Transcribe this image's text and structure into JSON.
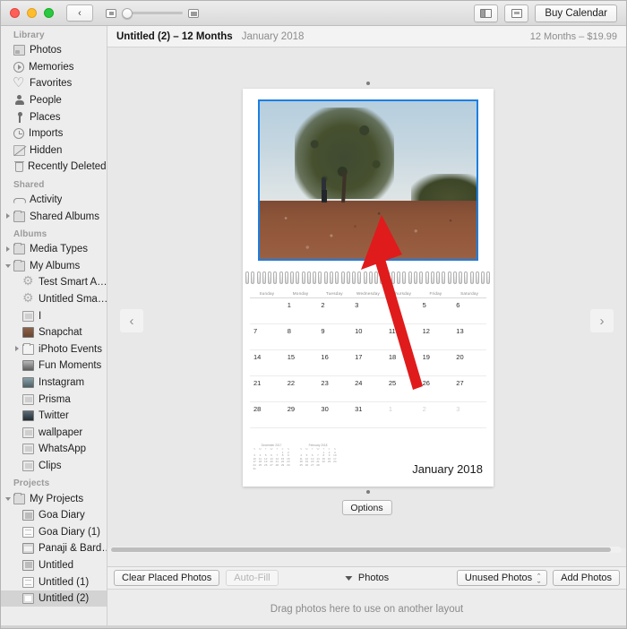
{
  "window": {
    "traffic_lights": [
      "close",
      "minimize",
      "zoom"
    ]
  },
  "toolbar": {
    "back_glyph": "‹",
    "zoom_small_icon": "small-thumbnail-icon",
    "zoom_large_icon": "large-thumbnail-icon",
    "split_view_icon": "split-view-icon",
    "page_view_icon": "page-view-icon",
    "buy_label": "Buy Calendar"
  },
  "sidebar": {
    "sections": [
      {
        "header": "Library",
        "items": [
          {
            "label": "Photos",
            "icon": "photos-icon",
            "indent": 0,
            "disclosure": "none",
            "selected": false
          },
          {
            "label": "Memories",
            "icon": "memories-icon",
            "indent": 0,
            "disclosure": "none",
            "selected": false
          },
          {
            "label": "Favorites",
            "icon": "heart-icon",
            "indent": 0,
            "disclosure": "none",
            "selected": false
          },
          {
            "label": "People",
            "icon": "people-icon",
            "indent": 0,
            "disclosure": "none",
            "selected": false
          },
          {
            "label": "Places",
            "icon": "pin-icon",
            "indent": 0,
            "disclosure": "none",
            "selected": false
          },
          {
            "label": "Imports",
            "icon": "clock-icon",
            "indent": 0,
            "disclosure": "none",
            "selected": false
          },
          {
            "label": "Hidden",
            "icon": "hidden-icon",
            "indent": 0,
            "disclosure": "none",
            "selected": false
          },
          {
            "label": "Recently Deleted",
            "icon": "trash-icon",
            "indent": 0,
            "disclosure": "none",
            "selected": false
          }
        ]
      },
      {
        "header": "Shared",
        "items": [
          {
            "label": "Activity",
            "icon": "cloud-icon",
            "indent": 0,
            "disclosure": "none",
            "selected": false
          },
          {
            "label": "Shared Albums",
            "icon": "folder-grey-icon",
            "indent": 0,
            "disclosure": "right",
            "selected": false
          }
        ]
      },
      {
        "header": "Albums",
        "items": [
          {
            "label": "Media Types",
            "icon": "folder-grey-icon",
            "indent": 0,
            "disclosure": "right",
            "selected": false
          },
          {
            "label": "My Albums",
            "icon": "folder-grey-icon",
            "indent": 0,
            "disclosure": "down",
            "selected": false
          },
          {
            "label": "Test Smart A…",
            "icon": "gear-icon",
            "indent": 1,
            "disclosure": "none",
            "selected": false
          },
          {
            "label": "Untitled Sma…",
            "icon": "gear-icon",
            "indent": 1,
            "disclosure": "none",
            "selected": false
          },
          {
            "label": "I",
            "icon": "album-icon",
            "indent": 1,
            "disclosure": "none",
            "selected": false
          },
          {
            "label": "Snapchat",
            "icon": "album-thumb-snapchat-icon",
            "indent": 1,
            "disclosure": "none",
            "selected": false
          },
          {
            "label": "iPhoto Events",
            "icon": "folder-icon",
            "indent": 1,
            "disclosure": "right",
            "selected": false
          },
          {
            "label": "Fun Moments",
            "icon": "album-thumb-fun-icon",
            "indent": 1,
            "disclosure": "none",
            "selected": false
          },
          {
            "label": "Instagram",
            "icon": "album-thumb-instagram-icon",
            "indent": 1,
            "disclosure": "none",
            "selected": false
          },
          {
            "label": "Prisma",
            "icon": "album-icon",
            "indent": 1,
            "disclosure": "none",
            "selected": false
          },
          {
            "label": "Twitter",
            "icon": "album-thumb-twitter-icon",
            "indent": 1,
            "disclosure": "none",
            "selected": false
          },
          {
            "label": "wallpaper",
            "icon": "album-icon",
            "indent": 1,
            "disclosure": "none",
            "selected": false
          },
          {
            "label": "WhatsApp",
            "icon": "album-icon",
            "indent": 1,
            "disclosure": "none",
            "selected": false
          },
          {
            "label": "Clips",
            "icon": "album-icon",
            "indent": 1,
            "disclosure": "none",
            "selected": false
          }
        ]
      },
      {
        "header": "Projects",
        "items": [
          {
            "label": "My Projects",
            "icon": "folder-grey-icon",
            "indent": 0,
            "disclosure": "down",
            "selected": false
          },
          {
            "label": "Goa Diary",
            "icon": "project-book-icon",
            "indent": 1,
            "disclosure": "none",
            "selected": false
          },
          {
            "label": "Goa Diary (1)",
            "icon": "project-card-icon",
            "indent": 1,
            "disclosure": "none",
            "selected": false
          },
          {
            "label": "Panaji & Bard…",
            "icon": "project-wide-icon",
            "indent": 1,
            "disclosure": "none",
            "selected": false
          },
          {
            "label": "Untitled",
            "icon": "project-book-icon",
            "indent": 1,
            "disclosure": "none",
            "selected": false
          },
          {
            "label": "Untitled (1)",
            "icon": "project-card-icon",
            "indent": 1,
            "disclosure": "none",
            "selected": false
          },
          {
            "label": "Untitled (2)",
            "icon": "project-calendar-icon",
            "indent": 1,
            "disclosure": "none",
            "selected": true
          }
        ]
      }
    ]
  },
  "header": {
    "project_title": "Untitled (2) – 12 Months",
    "month_label": "January 2018",
    "price_label": "12 Months – $19.99"
  },
  "canvas": {
    "prev_glyph": "‹",
    "next_glyph": "›",
    "options_label": "Options",
    "photo_alt": "person standing beside a tree on red earth under a pale blue sky",
    "annotation": "red-arrow-pointing-to-photo"
  },
  "calendar": {
    "month_title": "January 2018",
    "day_headers": [
      "Sunday",
      "Monday",
      "Tuesday",
      "Wednesday",
      "Thursday",
      "Friday",
      "Saturday"
    ],
    "weeks": [
      [
        {
          "d": "",
          "mute": true
        },
        {
          "d": "1"
        },
        {
          "d": "2"
        },
        {
          "d": "3"
        },
        {
          "d": "4"
        },
        {
          "d": "5"
        },
        {
          "d": "6"
        }
      ],
      [
        {
          "d": "7"
        },
        {
          "d": "8"
        },
        {
          "d": "9"
        },
        {
          "d": "10"
        },
        {
          "d": "11"
        },
        {
          "d": "12"
        },
        {
          "d": "13"
        }
      ],
      [
        {
          "d": "14"
        },
        {
          "d": "15"
        },
        {
          "d": "16"
        },
        {
          "d": "17"
        },
        {
          "d": "18"
        },
        {
          "d": "19"
        },
        {
          "d": "20"
        }
      ],
      [
        {
          "d": "21"
        },
        {
          "d": "22"
        },
        {
          "d": "23"
        },
        {
          "d": "24"
        },
        {
          "d": "25"
        },
        {
          "d": "26"
        },
        {
          "d": "27"
        }
      ],
      [
        {
          "d": "28"
        },
        {
          "d": "29"
        },
        {
          "d": "30"
        },
        {
          "d": "31"
        },
        {
          "d": "1",
          "mute": true
        },
        {
          "d": "2",
          "mute": true
        },
        {
          "d": "3",
          "mute": true
        }
      ]
    ],
    "mini_calendars": [
      {
        "title": "December 2017",
        "dow": [
          "S",
          "M",
          "T",
          "W",
          "T",
          "F",
          "S"
        ],
        "cells": [
          "",
          "",
          "",
          "",
          "",
          "1",
          "2",
          "3",
          "4",
          "5",
          "6",
          "7",
          "8",
          "9",
          "10",
          "11",
          "12",
          "13",
          "14",
          "15",
          "16",
          "17",
          "18",
          "19",
          "20",
          "21",
          "22",
          "23",
          "24",
          "25",
          "26",
          "27",
          "28",
          "29",
          "30",
          "31",
          "",
          "",
          "",
          "",
          "",
          ""
        ]
      },
      {
        "title": "February 2018",
        "dow": [
          "S",
          "M",
          "T",
          "W",
          "T",
          "F",
          "S"
        ],
        "cells": [
          "",
          "",
          "",
          "",
          "1",
          "2",
          "3",
          "4",
          "5",
          "6",
          "7",
          "8",
          "9",
          "10",
          "11",
          "12",
          "13",
          "14",
          "15",
          "16",
          "17",
          "18",
          "19",
          "20",
          "21",
          "22",
          "23",
          "24",
          "25",
          "26",
          "27",
          "28",
          "",
          "",
          "",
          "",
          "",
          "",
          ""
        ]
      }
    ]
  },
  "bottom_bar": {
    "clear_label": "Clear Placed Photos",
    "autofill_label": "Auto-Fill",
    "photos_label": "Photos",
    "filter_value": "Unused Photos",
    "add_photos_label": "Add Photos"
  },
  "dropzone": {
    "text": "Drag photos here to use on another layout"
  },
  "colors": {
    "selection_blue": "#1b7fe3",
    "annotation_red": "#e01b1b",
    "window_bg": "#ececec",
    "sidebar_bg": "#ededed",
    "canvas_bg": "#e8e8e8"
  }
}
